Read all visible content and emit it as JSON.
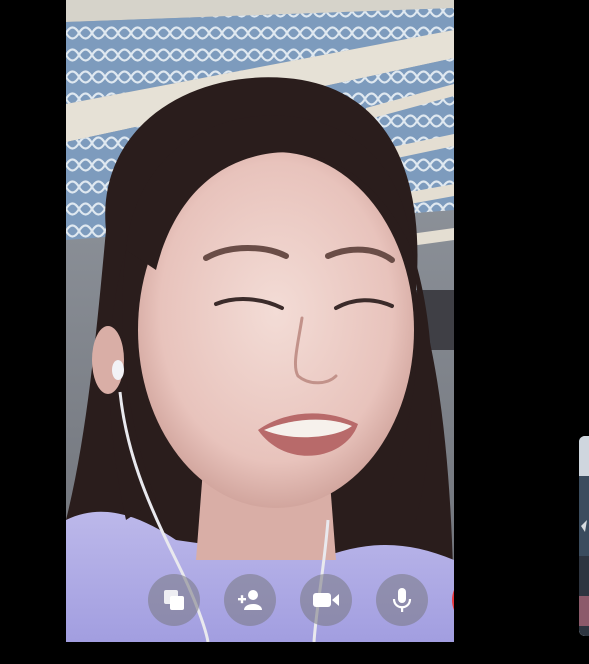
{
  "call": {
    "remote_video": {
      "label": "remote-participant-video"
    },
    "self_view": {
      "label": "self-view-thumbnail"
    }
  },
  "controls": [
    {
      "name": "switch-window-button",
      "icon": "switch-window-icon"
    },
    {
      "name": "add-person-button",
      "icon": "add-person-icon"
    },
    {
      "name": "video-toggle-button",
      "icon": "video-camera-icon"
    },
    {
      "name": "microphone-toggle-button",
      "icon": "microphone-icon"
    },
    {
      "name": "end-call-button",
      "icon": "phone-hangup-icon"
    }
  ],
  "colors": {
    "background": "#000000",
    "control_button": "#78788c",
    "end_call": "#e8383d",
    "icon": "#ffffff"
  }
}
